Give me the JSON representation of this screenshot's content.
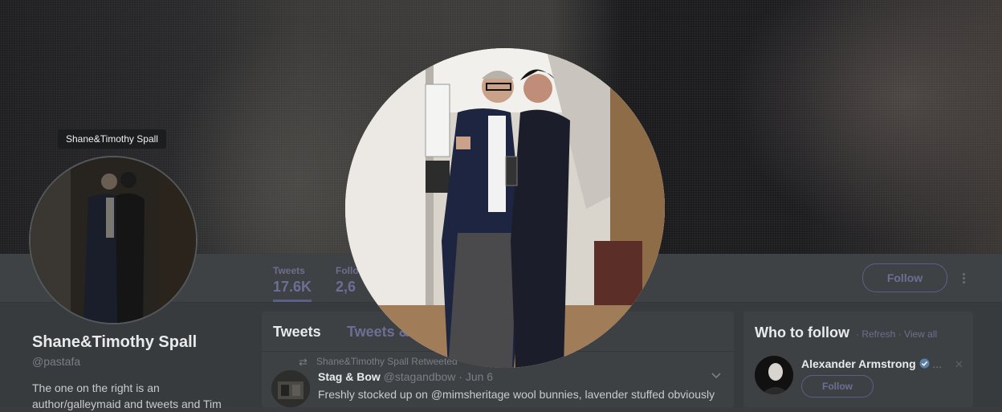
{
  "profile": {
    "display_name": "Shane&Timothy Spall",
    "handle": "@pastafa",
    "bio": "The one on the right is an author/galleymaid and tweets and Tim",
    "tooltip": "Shane&Timothy Spall"
  },
  "nav": {
    "stats": [
      {
        "label": "Tweets",
        "value": "17.6K"
      },
      {
        "label": "Follo",
        "value": "2,6"
      }
    ],
    "follow_label": "Follow"
  },
  "timeline": {
    "tabs": [
      "Tweets",
      "Tweets &"
    ],
    "retweet_label": "Shane&Timothy Spall Retweeted",
    "tweet": {
      "author": "Stag & Bow",
      "handle": "@stagandbow",
      "time": "· Jun 6",
      "text": "Freshly stocked up on @mimsheritage wool bunnies, lavender stuffed obviously"
    }
  },
  "who_to_follow": {
    "title": "Who to follow",
    "refresh": "· Refresh",
    "view_all": "· View all",
    "suggestion": {
      "name": "Alexander Armstrong",
      "ellipsis": "...",
      "follow_label": "Follow"
    }
  },
  "colors": {
    "accent": "#6c6f94",
    "banner_dark": "#1f1f22",
    "panel": "#3e4144"
  }
}
